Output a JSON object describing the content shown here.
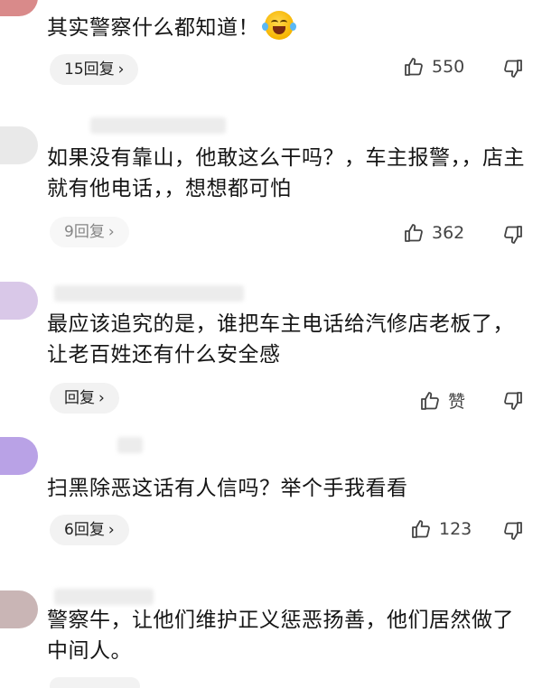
{
  "comments": [
    {
      "text": "其实警察什么都知道！",
      "has_emoji": true,
      "emoji": "rolling-laugh-emoji",
      "reply_label": "15回复",
      "like_count": "550"
    },
    {
      "text": "如果没有靠山，他敢这么干吗？，车主报警，，店主就有他电话，，想想都可怕",
      "reply_label": "9回复",
      "like_count": "362"
    },
    {
      "text": "最应该追究的是，谁把车主电话给汽修店老板了，让老百姓还有什么安全感",
      "reply_label": "回复",
      "like_count": "赞"
    },
    {
      "text": "扫黑除恶这话有人信吗？举个手我看看",
      "reply_label": "6回复",
      "like_count": "123"
    },
    {
      "text": "警察牛，让他们维护正义惩恶扬善，他们居然做了中间人。",
      "reply_label": "",
      "like_count": ""
    }
  ],
  "icons": {
    "like": "thumbs-up-icon",
    "dislike": "thumbs-down-icon",
    "chevron": "chevron-right-icon"
  },
  "colors": {
    "text": "#151515",
    "pill_bg": "#f2f2f2",
    "icon": "#444444"
  }
}
